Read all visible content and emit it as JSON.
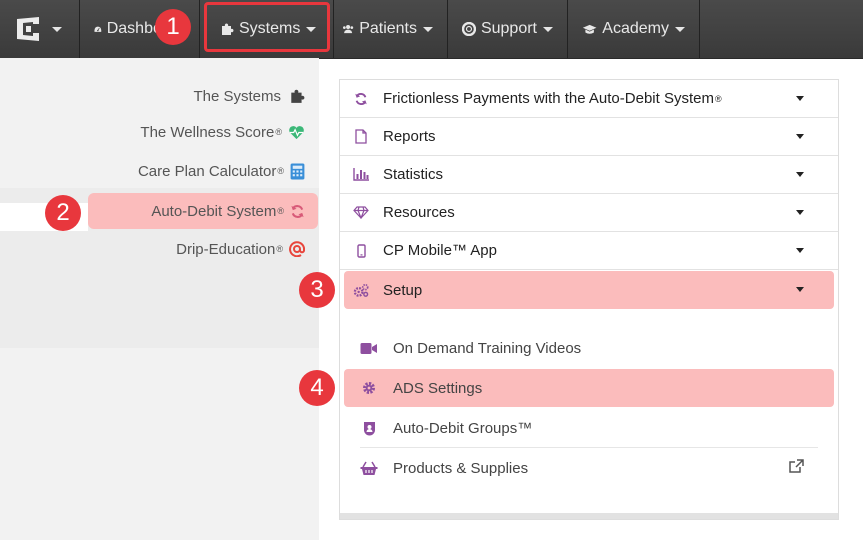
{
  "topnav": {
    "items": [
      {
        "label": "Dashboard",
        "icon": "dashboard-icon"
      },
      {
        "label": "Systems",
        "icon": "puzzle-icon"
      },
      {
        "label": "Patients",
        "icon": "users-icon"
      },
      {
        "label": "Support",
        "icon": "lifebuoy-icon"
      },
      {
        "label": "Academy",
        "icon": "graduation-cap-icon"
      }
    ]
  },
  "sidebar": {
    "items": [
      {
        "label": "The Systems",
        "reg": "",
        "icon": "puzzle-icon"
      },
      {
        "label": "The Wellness Score",
        "reg": "®",
        "icon": "heartbeat-icon"
      },
      {
        "label": "Care Plan Calculator",
        "reg": "®",
        "icon": "calculator-icon"
      },
      {
        "label": "Auto-Debit System",
        "reg": "®",
        "icon": "refresh-icon"
      },
      {
        "label": "Drip-Education",
        "reg": "®",
        "icon": "at-icon"
      }
    ]
  },
  "panel": {
    "rows": [
      {
        "label": "Frictionless Payments with the Auto-Debit System",
        "reg": "®",
        "icon": "refresh-icon"
      },
      {
        "label": "Reports",
        "reg": "",
        "icon": "file-icon"
      },
      {
        "label": "Statistics",
        "reg": "",
        "icon": "bar-chart-icon"
      },
      {
        "label": "Resources",
        "reg": "",
        "icon": "diamond-icon"
      },
      {
        "label": "CP Mobile™ App",
        "reg": "",
        "icon": "mobile-icon"
      },
      {
        "label": "Setup",
        "reg": "",
        "icon": "gears-icon"
      }
    ],
    "subitems": [
      {
        "label": "On Demand Training Videos",
        "icon": "video-camera-icon"
      },
      {
        "label": "ADS Settings",
        "icon": "gear-icon"
      },
      {
        "label": "Auto-Debit Groups™",
        "icon": "group-badge-icon"
      },
      {
        "label": "Products & Supplies",
        "icon": "basket-icon"
      }
    ]
  },
  "badges": [
    "1",
    "2",
    "3",
    "4"
  ],
  "colors": {
    "accent": "#e8373d",
    "highlight": "#fbbcbc",
    "icon_purple": "#8e4f9f",
    "nav_bg": "#404040"
  }
}
